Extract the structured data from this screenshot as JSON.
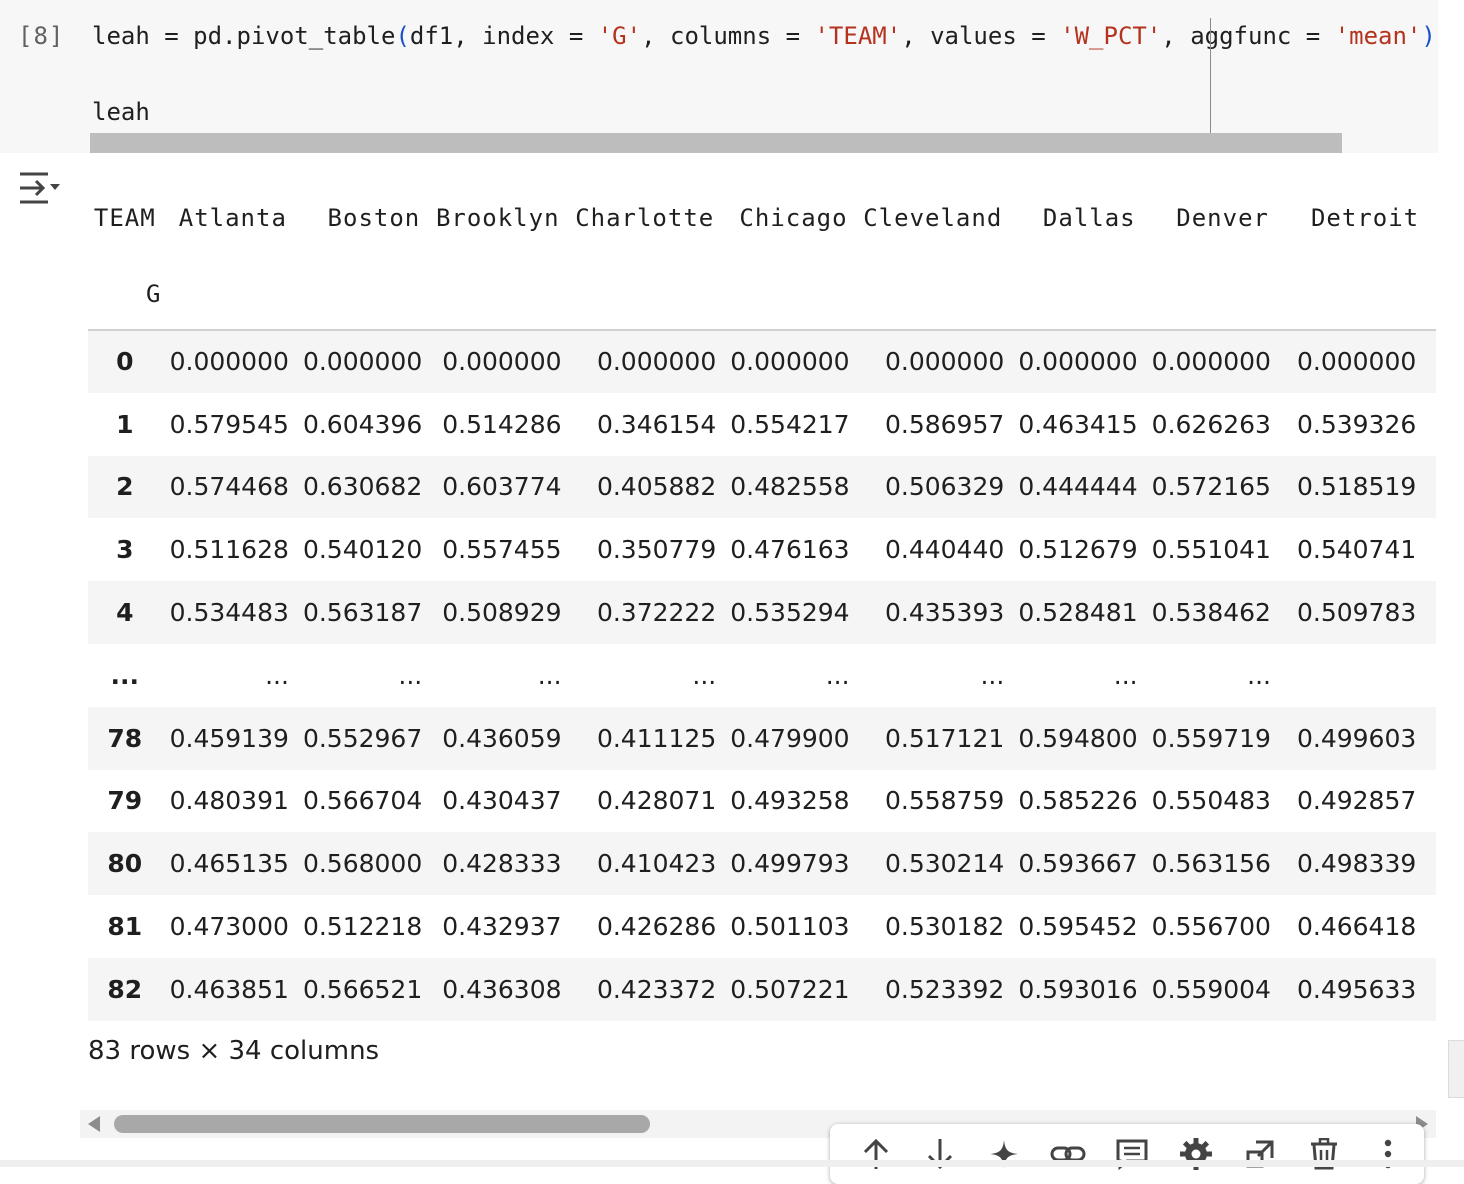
{
  "cell": {
    "exec_count": "[8]",
    "code_line1": {
      "p1": "leah = pd.pivot_table",
      "paren_open": "(",
      "p2": "df1, index = ",
      "s1": "'G'",
      "p3": ", columns = ",
      "s2": "'TEAM'",
      "p4": ", values = ",
      "s3": "'W_PCT'",
      "p5": ", aggfunc = ",
      "s4": "'mean'",
      "paren_close": ")"
    },
    "code_line2": "leah"
  },
  "table": {
    "columns_name": "TEAM",
    "index_name": "G",
    "columns": [
      "Atlanta",
      "Boston",
      "Brooklyn",
      "Charlotte",
      "Chicago",
      "Cleveland",
      "Dallas",
      "Denver",
      "Detroit"
    ],
    "rows": [
      {
        "index": "0",
        "cells": [
          "0.000000",
          "0.000000",
          "0.000000",
          "0.000000",
          "0.000000",
          "0.000000",
          "0.000000",
          "0.000000",
          "0.000000"
        ]
      },
      {
        "index": "1",
        "cells": [
          "0.579545",
          "0.604396",
          "0.514286",
          "0.346154",
          "0.554217",
          "0.586957",
          "0.463415",
          "0.626263",
          "0.539326"
        ]
      },
      {
        "index": "2",
        "cells": [
          "0.574468",
          "0.630682",
          "0.603774",
          "0.405882",
          "0.482558",
          "0.506329",
          "0.444444",
          "0.572165",
          "0.518519"
        ]
      },
      {
        "index": "3",
        "cells": [
          "0.511628",
          "0.540120",
          "0.557455",
          "0.350779",
          "0.476163",
          "0.440440",
          "0.512679",
          "0.551041",
          "0.540741"
        ]
      },
      {
        "index": "4",
        "cells": [
          "0.534483",
          "0.563187",
          "0.508929",
          "0.372222",
          "0.535294",
          "0.435393",
          "0.528481",
          "0.538462",
          "0.509783"
        ]
      },
      {
        "index": "...",
        "cells": [
          "...",
          "...",
          "...",
          "...",
          "...",
          "...",
          "...",
          "...",
          ""
        ]
      },
      {
        "index": "78",
        "cells": [
          "0.459139",
          "0.552967",
          "0.436059",
          "0.411125",
          "0.479900",
          "0.517121",
          "0.594800",
          "0.559719",
          "0.499603"
        ]
      },
      {
        "index": "79",
        "cells": [
          "0.480391",
          "0.566704",
          "0.430437",
          "0.428071",
          "0.493258",
          "0.558759",
          "0.585226",
          "0.550483",
          "0.492857"
        ]
      },
      {
        "index": "80",
        "cells": [
          "0.465135",
          "0.568000",
          "0.428333",
          "0.410423",
          "0.499793",
          "0.530214",
          "0.593667",
          "0.563156",
          "0.498339"
        ]
      },
      {
        "index": "81",
        "cells": [
          "0.473000",
          "0.512218",
          "0.432937",
          "0.426286",
          "0.501103",
          "0.530182",
          "0.595452",
          "0.556700",
          "0.466418"
        ]
      },
      {
        "index": "82",
        "cells": [
          "0.463851",
          "0.566521",
          "0.436308",
          "0.423372",
          "0.507221",
          "0.523392",
          "0.593016",
          "0.559004",
          "0.495633"
        ]
      }
    ],
    "shape_text": "83 rows × 34 columns"
  },
  "toolbar": {
    "items": [
      "move-up",
      "move-down",
      "gemini-sparkle",
      "link",
      "comment",
      "settings",
      "expand",
      "delete",
      "more"
    ]
  },
  "colors": {
    "string_token": "#b5331e",
    "paren_token": "#1a50c8",
    "code_bg": "#f7f7f7",
    "row_stripe": "#f5f5f5"
  }
}
